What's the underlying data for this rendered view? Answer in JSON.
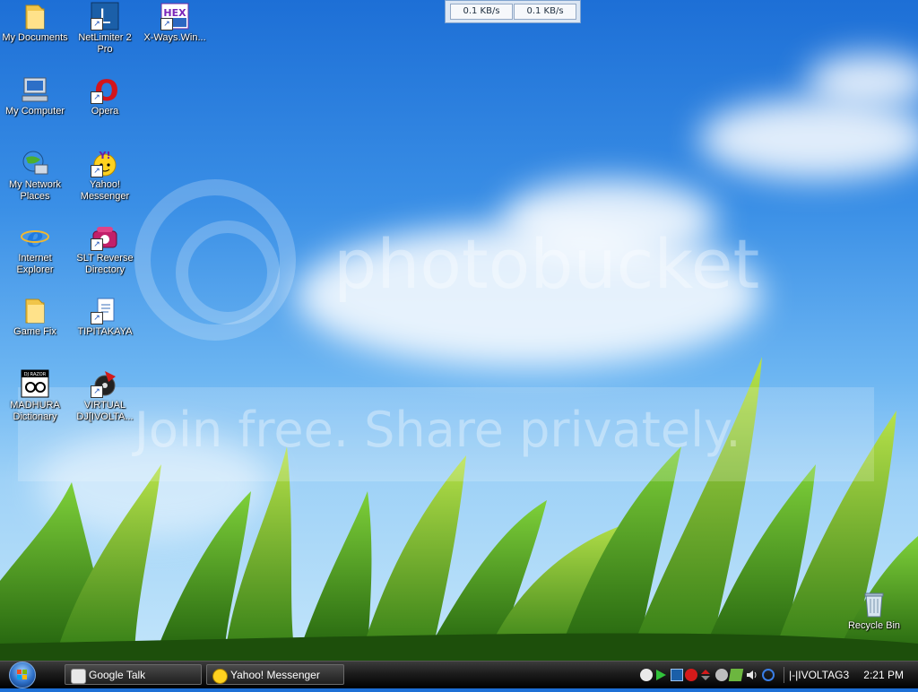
{
  "desktop": {
    "icons": [
      {
        "label": "My Documents"
      },
      {
        "label": "NetLimiter 2 Pro"
      },
      {
        "label": "X-Ways.Win..."
      },
      {
        "label": "My Computer"
      },
      {
        "label": "Opera"
      },
      {
        "label": "My Network Places"
      },
      {
        "label": "Yahoo! Messenger"
      },
      {
        "label": "Internet Explorer"
      },
      {
        "label": "SLT Reverse Directory"
      },
      {
        "label": "Game Fix"
      },
      {
        "label": "TIPITAKAYA"
      },
      {
        "label": "MADHURA Dictionary"
      },
      {
        "label": "VIRTUAL DJ[IVOLTA..."
      },
      {
        "label": "Recycle Bin"
      }
    ],
    "icon_glyphs": {
      "netlimiter": "L",
      "xways": "HEX",
      "opera": "O",
      "yahoo": "Y!",
      "ie": "e",
      "madhura": "DJ RAZOR"
    }
  },
  "watermark": {
    "line1": "photobucket",
    "line2": "Join free. Share privately."
  },
  "netlimiter_meter": {
    "download": "0.1 KB/s",
    "upload": "0.1 KB/s"
  },
  "taskbar": {
    "tasks": [
      {
        "label": "Google Talk"
      },
      {
        "label": "Yahoo! Messenger"
      }
    ],
    "tray_text": "|-|IVOLTAG3",
    "clock": "2:21 PM"
  },
  "colors": {
    "sky_top": "#1d6fd6",
    "grass": "#3f9a1e",
    "taskbar": "#1c1c1c"
  }
}
